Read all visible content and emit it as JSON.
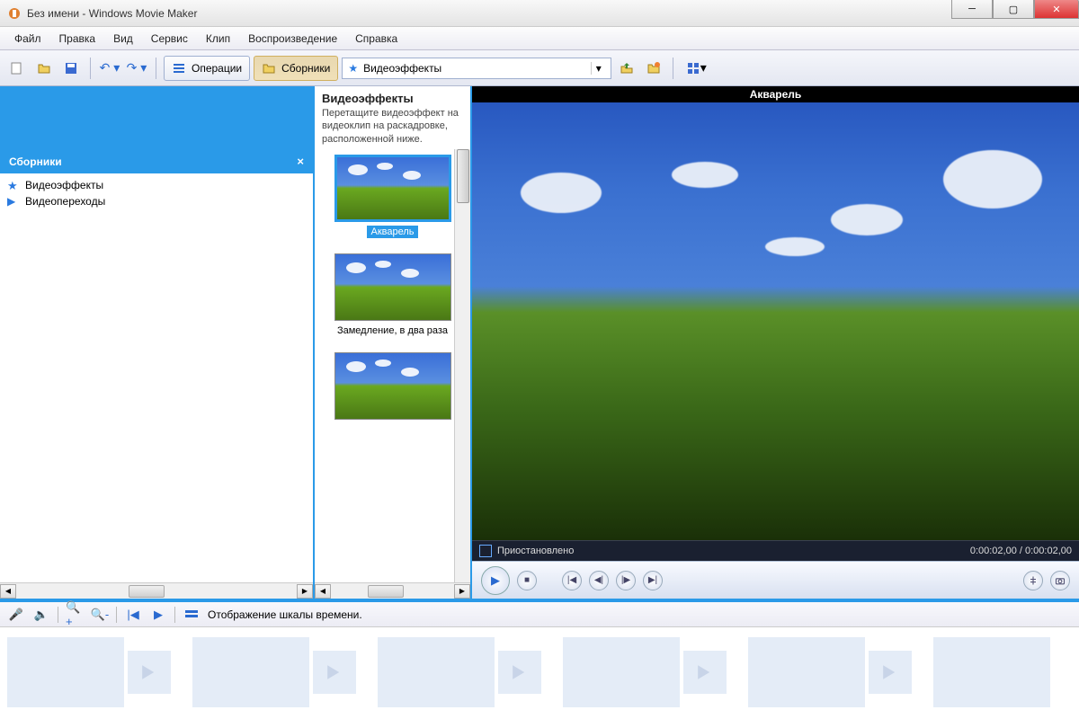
{
  "titlebar": {
    "text": "Без имени - Windows Movie Maker"
  },
  "menubar": {
    "file": "Файл",
    "edit": "Правка",
    "view": "Вид",
    "tools": "Сервис",
    "clip": "Клип",
    "play": "Воспроизведение",
    "help": "Справка"
  },
  "toolbar": {
    "operations": "Операции",
    "collections": "Сборники",
    "dropdown_value": "Видеоэффекты"
  },
  "sidebar": {
    "header": "Сборники",
    "items": [
      {
        "label": "Видеоэффекты"
      },
      {
        "label": "Видеопереходы"
      }
    ]
  },
  "effects_panel": {
    "title": "Видеоэффекты",
    "description": "Перетащите видеоэффект на видеоклип на раскадровке, расположенной ниже.",
    "items": [
      {
        "label": "Акварель"
      },
      {
        "label": "Замедление, в два раза"
      },
      {
        "label": ""
      }
    ]
  },
  "preview": {
    "title": "Акварель",
    "status": "Приостановлено",
    "time_current": "0:00:02,00",
    "time_total": "0:00:02,00"
  },
  "timeline": {
    "label": "Отображение шкалы времени."
  }
}
